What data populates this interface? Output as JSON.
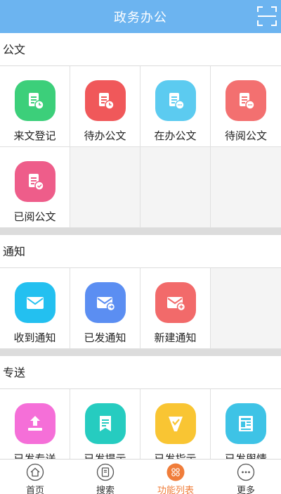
{
  "header": {
    "title": "政务办公"
  },
  "sections": [
    {
      "title": "公文",
      "items": [
        {
          "label": "来文登记",
          "icon": "document-clock-icon",
          "color": "#3ccf7a"
        },
        {
          "label": "待办公文",
          "icon": "document-clock-icon",
          "color": "#f0585a"
        },
        {
          "label": "在办公文",
          "icon": "document-dots-icon",
          "color": "#5ccbf0"
        },
        {
          "label": "待阅公文",
          "icon": "document-dots-icon",
          "color": "#f37070"
        },
        {
          "label": "已阅公文",
          "icon": "document-check-icon",
          "color": "#ee5d8a"
        }
      ]
    },
    {
      "title": "通知",
      "items": [
        {
          "label": "收到通知",
          "icon": "envelope-icon",
          "color": "#23c0f0"
        },
        {
          "label": "已发通知",
          "icon": "envelope-arrow-icon",
          "color": "#5b8ef2"
        },
        {
          "label": "新建通知",
          "icon": "envelope-plus-icon",
          "color": "#f26a6a"
        }
      ]
    },
    {
      "title": "专送",
      "items": [
        {
          "label": "已发专送",
          "icon": "upload-icon",
          "color": "#f56fd8"
        },
        {
          "label": "已发提示",
          "icon": "bookmark-list-icon",
          "color": "#26ccc0"
        },
        {
          "label": "已发指示",
          "icon": "flag-check-icon",
          "color": "#f9c533"
        },
        {
          "label": "已发舆情",
          "icon": "newspaper-icon",
          "color": "#3ec3e6"
        }
      ]
    }
  ],
  "tabbar": {
    "items": [
      {
        "label": "首页",
        "icon": "home-icon",
        "active": false
      },
      {
        "label": "搜索",
        "icon": "search-doc-icon",
        "active": false
      },
      {
        "label": "功能列表",
        "icon": "function-grid-icon",
        "active": true
      },
      {
        "label": "更多",
        "icon": "more-icon",
        "active": false
      }
    ],
    "active_color": "#f07d3a"
  }
}
